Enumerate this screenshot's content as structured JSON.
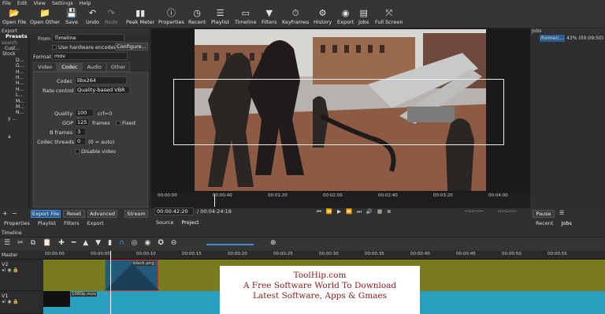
{
  "menu": [
    "File",
    "Edit",
    "View",
    "Settings",
    "Help"
  ],
  "toolbar": [
    {
      "label": "Open File",
      "icon": "folder-open-icon",
      "glyph": "📂"
    },
    {
      "label": "Open Other",
      "icon": "open-other-icon",
      "glyph": "▾"
    },
    {
      "label": "Save",
      "icon": "save-icon",
      "glyph": "💾"
    },
    {
      "label": "Undo",
      "icon": "undo-icon",
      "glyph": "↶"
    },
    {
      "label": "Redo",
      "icon": "redo-icon",
      "glyph": "↷"
    },
    {
      "label": "Peak Meter",
      "icon": "peak-meter-icon",
      "glyph": "▮"
    },
    {
      "label": "Properties",
      "icon": "properties-icon",
      "glyph": "ⓘ"
    },
    {
      "label": "Recent",
      "icon": "recent-icon",
      "glyph": "◷"
    },
    {
      "label": "Playlist",
      "icon": "playlist-icon",
      "glyph": "☰"
    },
    {
      "label": "Timeline",
      "icon": "timeline-icon",
      "glyph": "▭"
    },
    {
      "label": "Filters",
      "icon": "filters-icon",
      "glyph": "▼"
    },
    {
      "label": "Keyframes",
      "icon": "keyframes-icon",
      "glyph": "⏱"
    },
    {
      "label": "History",
      "icon": "history-icon",
      "glyph": "⚙"
    },
    {
      "label": "Export",
      "icon": "export-icon",
      "glyph": "◉"
    },
    {
      "label": "Jobs",
      "icon": "jobs-icon",
      "glyph": "▤"
    },
    {
      "label": "Full Screen",
      "icon": "fullscreen-icon",
      "glyph": "⤧"
    }
  ],
  "export_panel": {
    "title": "Export",
    "presets_title": "Presets",
    "search_placeholder": "search",
    "tree": [
      "Cust...",
      "Stock",
      "D...",
      "G...",
      "H...",
      "H...",
      "H...",
      "H...",
      "L...",
      "M...",
      "M...",
      "N...",
      "y ...",
      "a"
    ],
    "from_label": "From",
    "from_value": "Timeline",
    "hw_encoder_label": "Use hardware encoder",
    "configure_label": "Configure...",
    "format_label": "Format",
    "format_value": "mov",
    "tabs": [
      "Video",
      "Codec",
      "Audio",
      "Other"
    ],
    "active_tab": "Codec",
    "codec_label": "Codec",
    "codec_value": "libx264",
    "rate_control_label": "Rate control",
    "rate_control_value": "Quality-based VBR",
    "quality_label": "Quality",
    "quality_value": "100 %",
    "quality_extra": "crf=0",
    "gop_label": "GOP",
    "gop_value": "125",
    "gop_unit": "frames",
    "fixed_label": "Fixed",
    "bframes_label": "B frames",
    "bframes_value": "3",
    "threads_label": "Codec threads",
    "threads_value": "0",
    "threads_hint": "(0 = auto)",
    "disable_video_label": "Disable video",
    "buttons": [
      "Export File",
      "Reset",
      "Advanced",
      "Stream"
    ],
    "bottom_tabs": [
      "Properties",
      "Playlist",
      "Filters",
      "Export"
    ]
  },
  "player": {
    "ruler": [
      "00:00:00",
      "00:00:40",
      "00:01:20",
      "00:02:00",
      "00:02:40",
      "00:03:20",
      "00:04:00"
    ],
    "current_time": "00:00:42:20",
    "total_time": "/ 00:04:24:18",
    "in_point": "--:--:--:--",
    "out_point": "--:--:--:--",
    "tabs": [
      "Source",
      "Project"
    ]
  },
  "jobs": {
    "title": "Jobs",
    "job_name": "/home/c...",
    "job_progress": "43%",
    "job_time": "(00:09:50)",
    "pause_label": "Pause",
    "tabs": [
      "Recent",
      "Jobs"
    ]
  },
  "timeline": {
    "title": "Timeline",
    "master_label": "Master",
    "ruler": [
      "00:00:00",
      "00:00:05",
      "00:00:10",
      "00:00:15",
      "00:00:20",
      "00:00:25",
      "00:00:30",
      "00:00:35",
      "00:00:40",
      "00:00:45",
      "00:00:50",
      "00:00:55"
    ],
    "tracks": [
      {
        "name": "V2",
        "clip": "black.png"
      },
      {
        "name": "V1",
        "clip": "1080p.mov"
      }
    ]
  },
  "watermark": {
    "line1": "ToolHip.com",
    "line2": "A Free Software World To Download",
    "line3": "Latest Software, Apps & Gmaes"
  },
  "colors": {
    "accent": "#3a8fd8",
    "v2_track": "#7a7a1e",
    "v1_track": "#2aa0c0",
    "selection": "#2a5d8f"
  }
}
